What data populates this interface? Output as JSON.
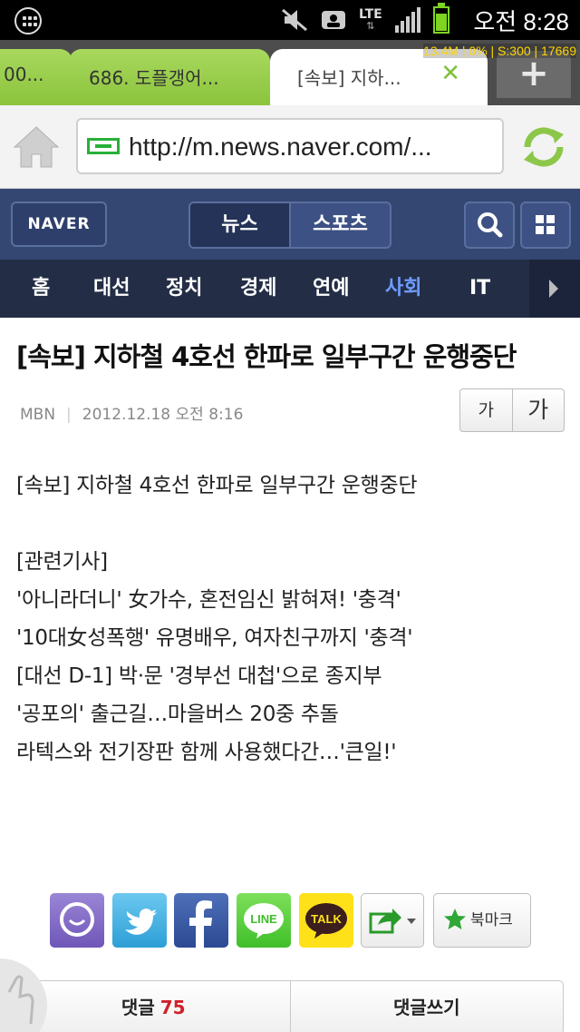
{
  "status_bar": {
    "network": "LTE",
    "time": "오전 8:28",
    "battery_level": 0.8
  },
  "tabs": [
    {
      "label": "00..."
    },
    {
      "label": "686. 도플갱어..."
    },
    {
      "label": "[속보] 지하...",
      "active": true
    }
  ],
  "debug_overlay": "13.4M | 0% | S:300 | 17669",
  "url_bar": {
    "url": "http://m.news.naver.com/..."
  },
  "naver_header": {
    "logo": "NAVER",
    "segments": [
      "뉴스",
      "스포츠"
    ],
    "active_segment": "뉴스"
  },
  "categories": [
    {
      "label": "홈"
    },
    {
      "label": "대선"
    },
    {
      "label": "정치"
    },
    {
      "label": "경제"
    },
    {
      "label": "연예"
    },
    {
      "label": "사회",
      "active": true
    },
    {
      "label": "IT"
    }
  ],
  "article": {
    "headline": "[속보] 지하철 4호선 한파로 일부구간 운행중단",
    "source": "MBN",
    "date": "2012.12.18 오전 8:16",
    "font_small_label": "가",
    "font_large_label": "가",
    "body": "[속보] 지하철 4호선 한파로 일부구간 운행중단\n\n[관련기사]\n'아니라더니' 女가수, 혼전임신 밝혀져! '충격'\n'10대女성폭행' 유명배우, 여자친구까지 '충격'\n[대선 D-1] 박·문 '경부선 대첩'으로 종지부\n'공포의' 출근길…마을버스 20중 추돌\n라텍스와 전기장판 함께 사용했다간…'큰일!'"
  },
  "share": {
    "services": [
      "naver-talk",
      "twitter",
      "facebook",
      "LINE",
      "TALK"
    ],
    "line_label": "LINE",
    "talk_label": "TALK",
    "bookmark_label": "북마크"
  },
  "comments": {
    "label": "댓글",
    "count": "75",
    "write_label": "댓글쓰기"
  },
  "colors": {
    "naver_header": "#344672",
    "category_nav": "#232e46",
    "tab_green": "#8bc43c",
    "active_category": "#6f9bff",
    "comment_count": "#d0202a"
  }
}
